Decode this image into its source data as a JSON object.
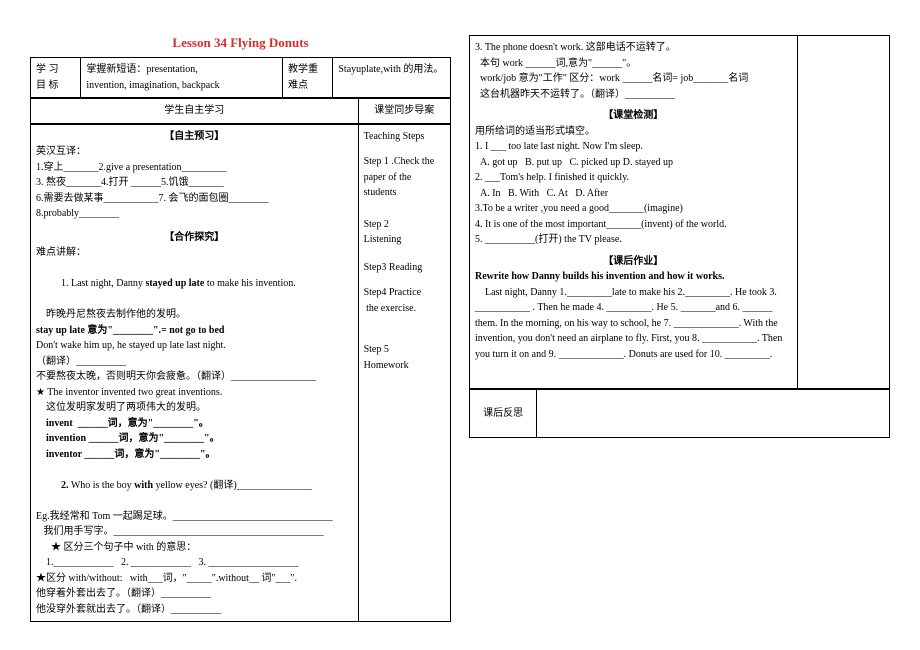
{
  "title": "Lesson 34  Flying Donuts",
  "goal_label": "学 习\n目 标",
  "goal_text": "掌握新短语：presentation,\ninvention, imagination, backpack",
  "focus_label": "教学重\n难点",
  "focus_text": "Stayuplate,with 的用法。",
  "self_study_header": "学生自主学习",
  "sync_header": "课堂同步导案",
  "preview_header": "【自主预习】",
  "preview_intro": "英汉互译：",
  "preview_items": [
    "1.穿上_______2.give a presentation_________",
    "3. 熬夜_______4.打开 ______5.饥饿_______",
    "6.需要去做某事___________7. 会飞的面包圈________",
    "8.probably________"
  ],
  "coop_header": "【合作探究】",
  "coop_intro": "难点讲解：",
  "coop_1": "1. Last night, Danny ",
  "coop_1b": "stayed up late",
  "coop_1c": " to make his invention.",
  "coop_1_cn": "    昨晚丹尼熬夜去制作他的发明。",
  "stay_up": "stay up late 意为\"________\".= not go to bed",
  "dont_wake": "Don't wake him up, he stayed up late last night.",
  "translate1": "（翻译）__________",
  "sleep_line": "不要熬夜太晚，否则明天你会疲惫。（翻译）_________________",
  "star_line": "★ The inventor invented two great inventions.",
  "star_cn": "    这位发明家发明了两项伟大的发明。",
  "invent1": "    invent  ______词，意为\"________\"。",
  "invent2": "    invention ______词，意为\"________\"。",
  "invent3": "    inventor ______词，意为\"________\"。",
  "item2": "2. Who is the boy with yellow eyes? (翻译)_______________",
  "eg": "Eg.我经常和 Tom 一起踢足球。________________________________",
  "write": "   我们用手写字。__________________________________________",
  "star2": "      ★ 区分三个句子中 with 的意思：",
  "star2_items": "    1.____________   2. ____________   3. __________________",
  "star3": "★区分 with/without:   with___词，\"_____\".without__ 词\"___\".",
  "out1": "他穿着外套出去了。（翻译）__________",
  "out2": "他没穿外套就出去了。（翻译）__________",
  "steps_header": "Teaching Steps",
  "step1": "Step 1 .Check the paper of the students",
  "step2": "Step 2\nListening",
  "step3": "Step3 Reading",
  "step4": "Step4 Practice\n the exercise.",
  "step5": "Step 5\nHomework",
  "right_top_lines": [
    "3. The phone doesn't work. 这部电话不运转了。",
    "  本句 work ______词,意为\"______\"。",
    "  work/job 意为\"工作\" 区分：work ______名词= job_______名词",
    "  这台机器昨天不运转了。（翻译）__________"
  ],
  "check_header": "【课堂检测】",
  "check_intro": "用所给词的适当形式填空。",
  "check_items": [
    "1. I ___ too late last night. Now I'm sleep.",
    "  A. got up   B. put up   C. picked up D. stayed up",
    "2. ___Tom's help. I finished it quickly.",
    "  A. In   B. With   C. At   D. After",
    "3.To be a writer ,you need a good_______(imagine)",
    "4. It is one of the most important_______(invent) of the world.",
    "5. __________(打开) the TV please."
  ],
  "homework_header": "【课后作业】",
  "homework_title": "Rewrite how Danny builds his invention and how it works.",
  "homework_text": "    Last night, Danny 1._________late to make his 2._________. He took 3. ___________ . Then he made 4. _________. He 5. _______and 6. ______ them. In the morning, on his way to school, he 7. _____________. With the invention, you don't need an airplane to fly. First, you 8. ___________. Then you turn it on and 9. _____________. Donuts are used for 10. _________.",
  "reflect": "课后反思"
}
